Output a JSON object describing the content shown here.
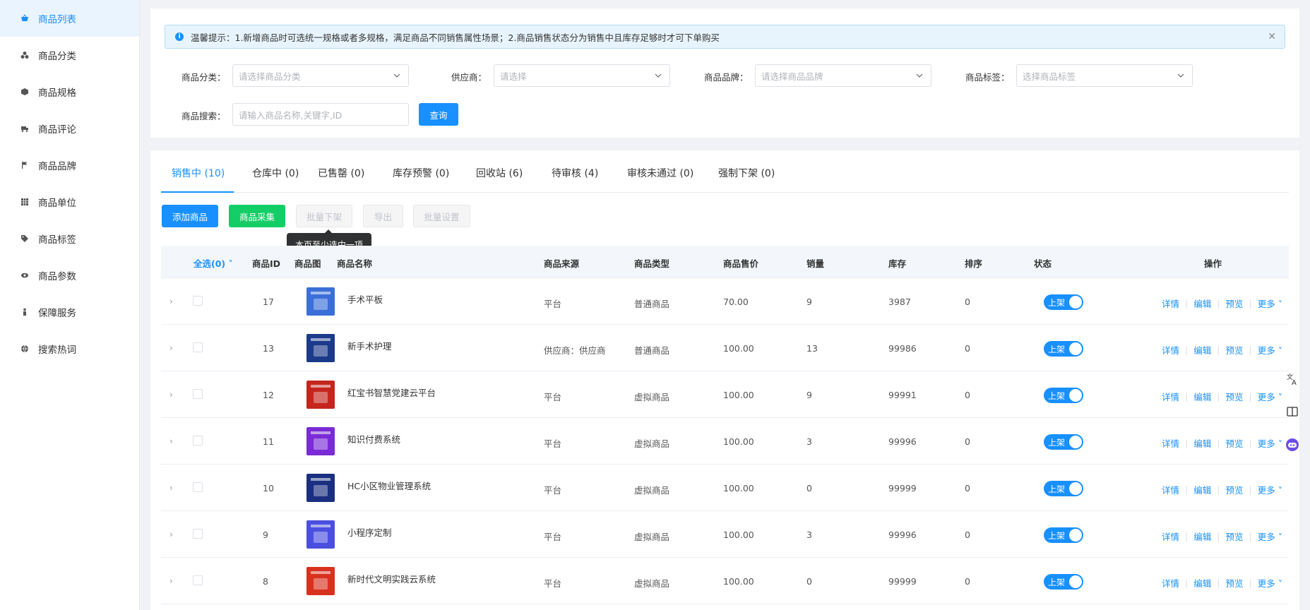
{
  "sidebar": {
    "items": [
      {
        "label": "商品列表",
        "icon": "basket-icon",
        "active": true
      },
      {
        "label": "商品分类",
        "icon": "category-icon"
      },
      {
        "label": "商品规格",
        "icon": "cube-icon"
      },
      {
        "label": "商品评论",
        "icon": "truck-icon"
      },
      {
        "label": "商品品牌",
        "icon": "flag-icon"
      },
      {
        "label": "商品单位",
        "icon": "grid-icon"
      },
      {
        "label": "商品标签",
        "icon": "tag-icon"
      },
      {
        "label": "商品参数",
        "icon": "eye-icon"
      },
      {
        "label": "保障服务",
        "icon": "person-icon"
      },
      {
        "label": "搜索热词",
        "icon": "globe-icon"
      }
    ]
  },
  "notice": {
    "text": "温馨提示：1.新增商品时可选统一规格或者多规格，满足商品不同销售属性场景；2.商品销售状态分为销售中且库存足够时才可下单购买"
  },
  "filters": {
    "category_label": "商品分类：",
    "category_placeholder": "请选择商品分类",
    "supplier_label": "供应商：",
    "supplier_placeholder": "请选择",
    "brand_label": "商品品牌：",
    "brand_placeholder": "请选择商品品牌",
    "tag_label": "商品标签：",
    "tag_placeholder": "选择商品标签",
    "search_label": "商品搜索：",
    "search_placeholder": "请输入商品名称,关键字,ID",
    "query_button": "查询"
  },
  "tabs": [
    {
      "label": "销售中 (10)",
      "active": true
    },
    {
      "label": "仓库中 (0)"
    },
    {
      "label": "已售罄 (0)"
    },
    {
      "label": "库存预警 (0)"
    },
    {
      "label": "回收站 (6)"
    },
    {
      "label": "待审核 (4)"
    },
    {
      "label": "审核未通过 (0)"
    },
    {
      "label": "强制下架 (0)"
    }
  ],
  "actions": {
    "add": "添加商品",
    "collect": "商品采集",
    "batch_off": "批量下架",
    "export": "导出",
    "batch_set": "批量设置",
    "tooltip": "本页至少选中一项"
  },
  "table": {
    "headers": {
      "select_all": "全选(0)",
      "id": "商品ID",
      "image": "商品图",
      "name": "商品名称",
      "source": "商品来源",
      "type": "商品类型",
      "price": "商品售价",
      "sales": "销量",
      "stock": "库存",
      "sort": "排序",
      "status": "状态",
      "ops": "操作"
    },
    "switch_label": "上架",
    "op_labels": {
      "detail": "详情",
      "edit": "编辑",
      "preview": "预览",
      "more": "更多"
    },
    "rows": [
      {
        "id": "17",
        "name": "手术平板",
        "source": "平台",
        "type": "普通商品",
        "price": "70.00",
        "sales": "9",
        "stock": "3987",
        "sort": "0",
        "thumb_color": "#3b6fd8"
      },
      {
        "id": "13",
        "name": "新手术护理",
        "source": "供应商：供应商",
        "type": "普通商品",
        "price": "100.00",
        "sales": "13",
        "stock": "99986",
        "sort": "0",
        "thumb_color": "#1b3a8a"
      },
      {
        "id": "12",
        "name": "红宝书智慧党建云平台",
        "source": "平台",
        "type": "虚拟商品",
        "price": "100.00",
        "sales": "9",
        "stock": "99991",
        "sort": "0",
        "thumb_color": "#c4261d"
      },
      {
        "id": "11",
        "name": "知识付费系统",
        "source": "平台",
        "type": "虚拟商品",
        "price": "100.00",
        "sales": "3",
        "stock": "99996",
        "sort": "0",
        "thumb_color": "#7a2bd6"
      },
      {
        "id": "10",
        "name": "HC小区物业管理系统",
        "source": "平台",
        "type": "虚拟商品",
        "price": "100.00",
        "sales": "0",
        "stock": "99999",
        "sort": "0",
        "thumb_color": "#1a2f80"
      },
      {
        "id": "9",
        "name": "小程序定制",
        "source": "平台",
        "type": "虚拟商品",
        "price": "100.00",
        "sales": "3",
        "stock": "99996",
        "sort": "0",
        "thumb_color": "#4b4fe0"
      },
      {
        "id": "8",
        "name": "新时代文明实践云系统",
        "source": "平台",
        "type": "虚拟商品",
        "price": "100.00",
        "sales": "0",
        "stock": "99999",
        "sort": "0",
        "thumb_color": "#d8321f"
      }
    ]
  },
  "float_icons": [
    "translate-icon",
    "reader-icon",
    "assistant-icon"
  ]
}
